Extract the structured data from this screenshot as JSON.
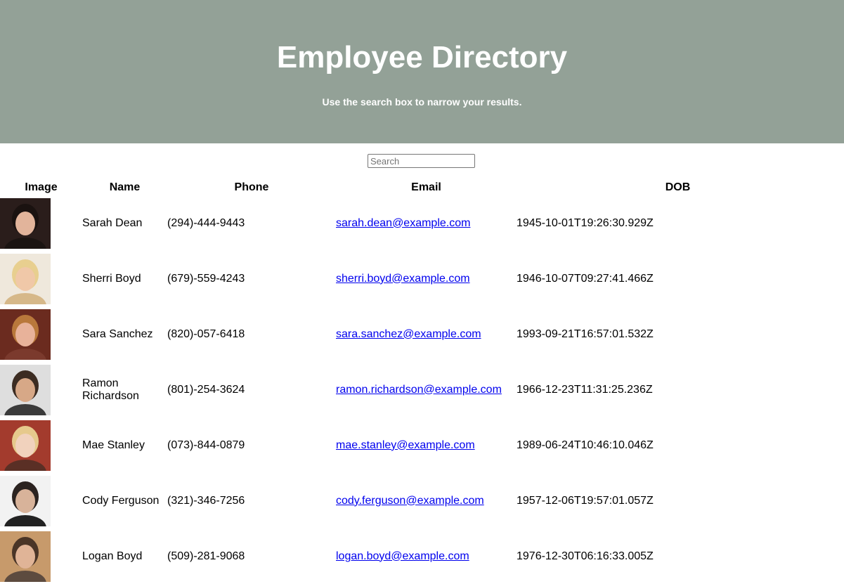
{
  "header": {
    "title": "Employee Directory",
    "subtitle": "Use the search box to narrow your results."
  },
  "search": {
    "placeholder": "Search",
    "value": ""
  },
  "table": {
    "columns": [
      "Image",
      "Name",
      "Phone",
      "Email",
      "DOB"
    ],
    "rows": [
      {
        "name": "Sarah Dean",
        "phone": "(294)-444-9443",
        "email": "sarah.dean@example.com",
        "dob": "1945-10-01T19:26:30.929Z"
      },
      {
        "name": "Sherri Boyd",
        "phone": "(679)-559-4243",
        "email": "sherri.boyd@example.com",
        "dob": "1946-10-07T09:27:41.466Z"
      },
      {
        "name": "Sara Sanchez",
        "phone": "(820)-057-6418",
        "email": "sara.sanchez@example.com",
        "dob": "1993-09-21T16:57:01.532Z"
      },
      {
        "name": "Ramon Richardson",
        "phone": "(801)-254-3624",
        "email": "ramon.richardson@example.com",
        "dob": "1966-12-23T11:31:25.236Z"
      },
      {
        "name": "Mae Stanley",
        "phone": "(073)-844-0879",
        "email": "mae.stanley@example.com",
        "dob": "1989-06-24T10:46:10.046Z"
      },
      {
        "name": "Cody Ferguson",
        "phone": "(321)-346-7256",
        "email": "cody.ferguson@example.com",
        "dob": "1957-12-06T19:57:01.057Z"
      },
      {
        "name": "Logan Boyd",
        "phone": "(509)-281-9068",
        "email": "logan.boyd@example.com",
        "dob": "1976-12-30T06:16:33.005Z"
      }
    ]
  },
  "colors": {
    "header_bg": "#93a197",
    "link": "#0000ee"
  },
  "avatars": [
    {
      "bg": "#2a1d1b",
      "skin": "#e2b49b",
      "hair": "#1a1210",
      "shirt": "#1b1412"
    },
    {
      "bg": "#efe8dc",
      "skin": "#f0c8a8",
      "hair": "#e8cf8f",
      "shirt": "#d6b889"
    },
    {
      "bg": "#6b2b1f",
      "skin": "#e8b29a",
      "hair": "#b9783b",
      "shirt": "#7b3a2d"
    },
    {
      "bg": "#dedede",
      "skin": "#d7a887",
      "hair": "#3c2c22",
      "shirt": "#3b3b3b"
    },
    {
      "bg": "#a33b2d",
      "skin": "#f1d2bd",
      "hair": "#e6c98c",
      "shirt": "#5a2f25"
    },
    {
      "bg": "#f2f2f2",
      "skin": "#d8b39a",
      "hair": "#2b2320",
      "shirt": "#222222"
    },
    {
      "bg": "#c79a6b",
      "skin": "#e0b497",
      "hair": "#4a3527",
      "shirt": "#5d4b3f"
    }
  ]
}
